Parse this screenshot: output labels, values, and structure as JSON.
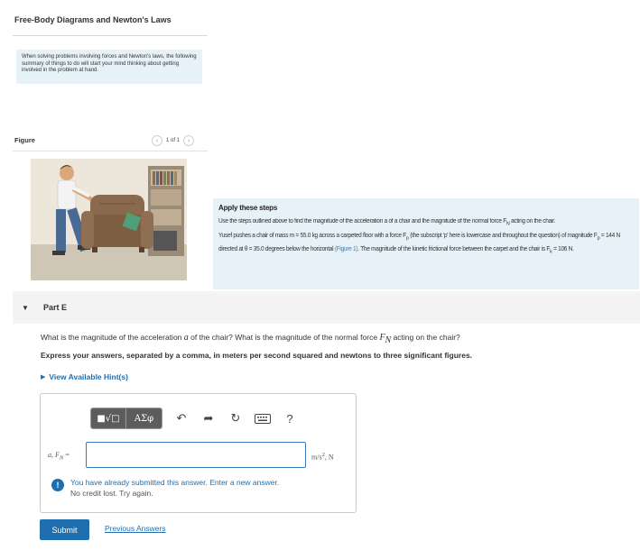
{
  "page": {
    "title": "Free-Body Diagrams and Newton's Laws"
  },
  "intro": {
    "text": "When solving problems involving forces and Newton's laws, the following summary of things to do will start your mind thinking about getting involved in the problem at hand."
  },
  "figure": {
    "label": "Figure",
    "pager_text": "1 of 1",
    "prev_icon": "chevron-left-icon",
    "next_icon": "chevron-right-icon"
  },
  "steps": {
    "title": "Apply these steps",
    "line1": "Use the steps outlined above to find the magnitude of the acceleration a of a chair and the magnitude of the normal force F",
    "line1_sub": "N",
    "line1_end": " acting on the chair.",
    "p2_a": "Yusef pushes a chair of mass m = 55.0 kg across a carpeted floor with a force F",
    "p2_sub": "p",
    "p2_b": " (the subscript 'p' here is lowercase and throughout the question) of magnitude F",
    "p2_c": " = 144 N directed at θ = 35.0 degrees below the horizontal ",
    "p2_link": "(Figure 1)",
    "p2_d": ". The magnitude of the kinetic frictional force between the carpet and the chair is F",
    "p2_sub2": "k",
    "p2_e": " = 106 N."
  },
  "part": {
    "title": "Part E",
    "question_a": "What is the magnitude of the acceleration ",
    "question_var_a": "a",
    "question_b": " of the chair? What is the magnitude of the normal force ",
    "question_var_fn": "F",
    "question_var_fn_sub": "N",
    "question_c": " acting on the chair?",
    "instruction": "Express your answers, separated by a comma, in meters per second squared and newtons to three significant figures.",
    "hint_label": "View Available Hint(s)"
  },
  "answer": {
    "toolbar_btn_a": "■√□",
    "toolbar_btn_b": "ΑΣφ",
    "undo_icon": "undo-icon",
    "redo_icon": "redo-icon",
    "reset_icon": "reset-icon",
    "keyboard_icon": "keyboard-icon",
    "help_label": "?",
    "label_a": "a, F",
    "label_sub": "N",
    "label_eq": " =",
    "input_value": "",
    "unit_a": "m/s",
    "unit_sup": "2",
    "unit_b": ", N",
    "feedback_line1": "You have already submitted this answer. Enter a new answer.",
    "feedback_line2": "No credit lost. Try again."
  },
  "actions": {
    "submit_label": "Submit",
    "previous_answers_label": "Previous Answers"
  },
  "colors": {
    "link": "#1f6fb0",
    "info_bg": "#e6f2f7",
    "submit_bg": "#1f6fb0"
  }
}
